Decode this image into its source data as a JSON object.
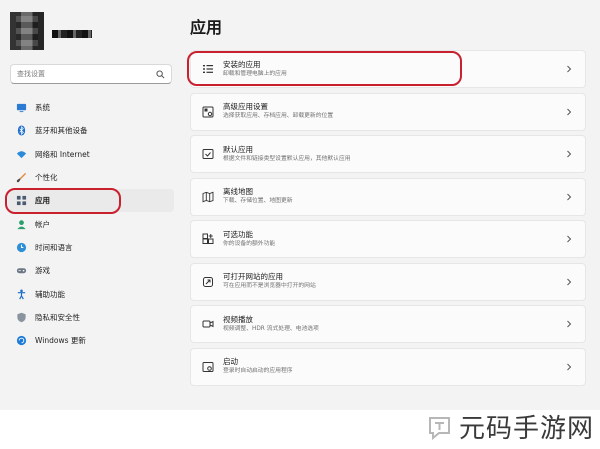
{
  "window": {
    "page_title": "应用"
  },
  "search": {
    "placeholder": "查找设置"
  },
  "sidebar": {
    "items": [
      {
        "label": "系统",
        "icon": "system-icon"
      },
      {
        "label": "蓝牙和其他设备",
        "icon": "bluetooth-icon"
      },
      {
        "label": "网络和 Internet",
        "icon": "wifi-icon"
      },
      {
        "label": "个性化",
        "icon": "brush-icon"
      },
      {
        "label": "应用",
        "icon": "apps-icon",
        "selected": true
      },
      {
        "label": "帐户",
        "icon": "account-icon"
      },
      {
        "label": "时间和语言",
        "icon": "globe-clock-icon"
      },
      {
        "label": "游戏",
        "icon": "gamepad-icon"
      },
      {
        "label": "辅助功能",
        "icon": "accessibility-icon"
      },
      {
        "label": "隐私和安全性",
        "icon": "shield-icon"
      },
      {
        "label": "Windows 更新",
        "icon": "windows-update-icon"
      }
    ]
  },
  "cards": [
    {
      "title": "安装的应用",
      "subtitle": "卸载和管理电脑上的应用",
      "icon": "installed-apps-icon"
    },
    {
      "title": "高级应用设置",
      "subtitle": "选择获取应用、存档应用、卸载更新的位置",
      "icon": "advanced-apps-icon"
    },
    {
      "title": "默认应用",
      "subtitle": "根据文件和链接类型设置默认应用，其他默认应用",
      "icon": "default-apps-icon"
    },
    {
      "title": "离线地图",
      "subtitle": "下载、存储位置、地图更新",
      "icon": "offline-maps-icon"
    },
    {
      "title": "可选功能",
      "subtitle": "你的设备的额外功能",
      "icon": "optional-features-icon"
    },
    {
      "title": "可打开网站的应用",
      "subtitle": "可在应用而不是浏览器中打开的网站",
      "icon": "apps-for-websites-icon"
    },
    {
      "title": "视频播放",
      "subtitle": "视频调整、HDR 流式处理、电池选项",
      "icon": "video-playback-icon"
    },
    {
      "title": "启动",
      "subtitle": "登录时自动启动的应用程序",
      "icon": "startup-icon"
    }
  ],
  "colors": {
    "highlight_red": "#c8202f",
    "accent_blue": "#0067c0"
  },
  "watermark": {
    "text": "元码手游网"
  }
}
